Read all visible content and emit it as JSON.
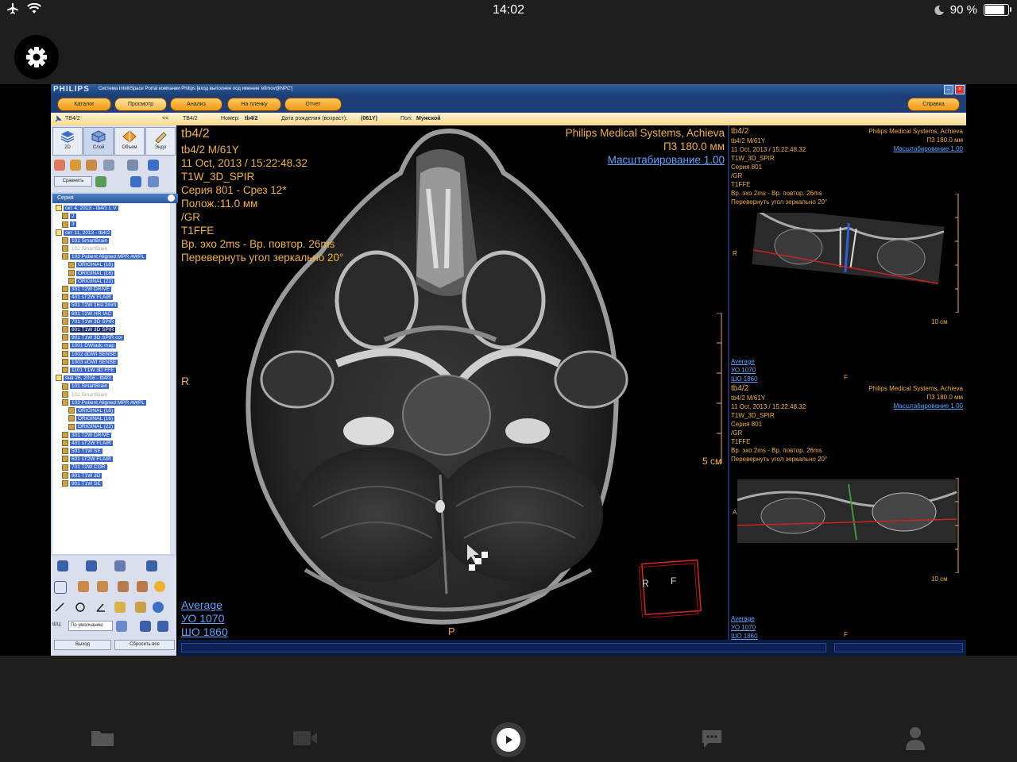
{
  "status_bar": {
    "time": "14:02",
    "battery": "90 %",
    "battery_level": 0.9
  },
  "app": {
    "brand": "PHILIPS",
    "window_title": "Система IntelliSpace Portal компании Philips [вход выполнен под именем 'efimov@NPC']",
    "menu": {
      "catalog": "Каталог",
      "view": "Просмотр",
      "analysis": "Анализ",
      "film": "На пленку",
      "report": "Отчет",
      "help": "Справка"
    },
    "infobar": {
      "patient_tab": "TB4/2",
      "collapse": "<<",
      "name": "TB4/2",
      "number_label": "Номер:",
      "number_value": "tb4/2",
      "dob_label": "Дата рождения (возраст):",
      "dob_value": "(061Y)",
      "sex_label": "Пол:",
      "sex_value": "Мужской"
    },
    "tools": {
      "btn_2d": "2D",
      "btn_slice": "Слой",
      "btn_volume": "Объем",
      "btn_endo": "Эндо",
      "compare": "Сравнить"
    },
    "series_header": "Серия",
    "series_tree": [
      {
        "label": "окт 4, 2013 - tb4/1 L V",
        "style": "blue",
        "indent": 0,
        "type": "study"
      },
      {
        "label": "2",
        "style": "blue",
        "indent": 1,
        "type": "series"
      },
      {
        "label": "3",
        "style": "blue",
        "indent": 1,
        "type": "series"
      },
      {
        "label": "окт 11, 2013 - tb4/2",
        "style": "blue",
        "indent": 0,
        "type": "study"
      },
      {
        "label": "101 SmartBrain",
        "style": "blue",
        "indent": 1,
        "type": "series"
      },
      {
        "label": "102 SmartBrain",
        "style": "grey",
        "indent": 1,
        "type": "series"
      },
      {
        "label": "103 Patient Aligned MPR AWPL",
        "style": "blue",
        "indent": 1,
        "type": "series"
      },
      {
        "label": "ORIGINAL (16)",
        "style": "blue",
        "indent": 2,
        "type": "series"
      },
      {
        "label": "ORIGINAL (16)",
        "style": "blue",
        "indent": 2,
        "type": "series"
      },
      {
        "label": "ORIGINAL (22)",
        "style": "blue",
        "indent": 2,
        "type": "series"
      },
      {
        "label": "301 T2W DRIVE",
        "style": "blue",
        "indent": 1,
        "type": "series"
      },
      {
        "label": "401 sT2W FLAIR",
        "style": "blue",
        "indent": 1,
        "type": "series"
      },
      {
        "label": "501 T2W 16sl 2mm",
        "style": "blue",
        "indent": 1,
        "type": "series"
      },
      {
        "label": "601 T2W HR IAC",
        "style": "blue",
        "indent": 1,
        "type": "series"
      },
      {
        "label": "701 T1W 3D SPIR",
        "style": "blue",
        "indent": 1,
        "type": "series"
      },
      {
        "label": "801 T1W 3D SPIR",
        "style": "dark",
        "indent": 1,
        "type": "series"
      },
      {
        "label": "901 T1W 3D SPIR cor",
        "style": "blue",
        "indent": 1,
        "type": "series"
      },
      {
        "label": "1001 DWIadc map",
        "style": "blue",
        "indent": 1,
        "type": "series"
      },
      {
        "label": "1002 dDWI SENSE",
        "style": "blue",
        "indent": 1,
        "type": "series"
      },
      {
        "label": "1003 eDWI SENSE",
        "style": "blue",
        "indent": 1,
        "type": "series"
      },
      {
        "label": "1101 T1W 3D FFE",
        "style": "blue",
        "indent": 1,
        "type": "series"
      },
      {
        "label": "янв 26, 2016 - tb4/3",
        "style": "blue",
        "indent": 0,
        "type": "study"
      },
      {
        "label": "101 SmartBrain",
        "style": "blue",
        "indent": 1,
        "type": "series"
      },
      {
        "label": "102 SmartBrain",
        "style": "grey",
        "indent": 1,
        "type": "series"
      },
      {
        "label": "103 Patient Aligned MPR AWPL",
        "style": "blue",
        "indent": 1,
        "type": "series"
      },
      {
        "label": "ORIGINAL (16)",
        "style": "blue",
        "indent": 2,
        "type": "series"
      },
      {
        "label": "ORIGINAL (16)",
        "style": "blue",
        "indent": 2,
        "type": "series"
      },
      {
        "label": "ORIGINAL (22)",
        "style": "blue",
        "indent": 2,
        "type": "series"
      },
      {
        "label": "301 T2W DRIVE",
        "style": "blue",
        "indent": 1,
        "type": "series"
      },
      {
        "label": "401 sT2W FLAIR",
        "style": "blue",
        "indent": 1,
        "type": "series"
      },
      {
        "label": "501 T1W SE",
        "style": "blue",
        "indent": 1,
        "type": "series"
      },
      {
        "label": "601 sT2W FLAIR",
        "style": "blue",
        "indent": 1,
        "type": "series"
      },
      {
        "label": "701 T2W COR",
        "style": "blue",
        "indent": 1,
        "type": "series"
      },
      {
        "label": "801 T1W 3D",
        "style": "blue",
        "indent": 1,
        "type": "series"
      },
      {
        "label": "901 T1W SE",
        "style": "blue",
        "indent": 1,
        "type": "series"
      }
    ],
    "bottom_tools": {
      "wl_label": "ШЦ:",
      "wl_select": "По умолчанию",
      "exit": "Выход",
      "reset_all": "Сбросить все"
    },
    "main_view": {
      "title": "tb4/2",
      "lines": [
        "tb4/2 M/61Y",
        "11 Oct, 2013 / 15:22:48.32",
        "T1W_3D_SPIR",
        "Серия 801 - Срез 12*",
        "Полож.:11.0 мм",
        "/GR",
        "T1FFE",
        "Вр. эхо   2ms - Вр. повтор.  26ms",
        "Перевернуть угол зеркально 20°"
      ],
      "vendor": "Philips Medical Systems, Achieva",
      "fov": "П3 180.0 мм",
      "zoom": "Масштабирование 1.00",
      "orient_r": "R",
      "orient_p": "P",
      "scale": "5 см",
      "wl_average": "Average",
      "wl_center": "УО   1070",
      "wl_width": "ШО  1860",
      "cube_r": "R",
      "cube_f": "F"
    },
    "side_view_1": {
      "title": "tb4/2",
      "lines": [
        "tb4/2 M/61Y",
        "11 Oct, 2013 / 15:22:48.32",
        "T1W_3D_SPIR",
        "Серия 801",
        "/GR",
        "T1FFE",
        "Вр. эхо   2ms - Вр. повтор.  26ms",
        "Перевернуть угол зеркально 20°"
      ],
      "vendor": "Philips Medical Systems, Achieva",
      "fov": "П3 180.0 мм",
      "zoom": "Масштабирование 1.00",
      "orient_r": "R",
      "orient_f": "F",
      "scale": "10 см",
      "wl_average": "Average",
      "wl_center": "УО   1070",
      "wl_width": "ШО   1860"
    },
    "side_view_2": {
      "title": "tb4/2",
      "lines": [
        "tb4/2 M/61Y",
        "11 Oct, 2013 / 15:22:48.32",
        "T1W_3D_SPIR",
        "Серия 801",
        "/GR",
        "T1FFE",
        "Вр. эхо   2ms - Вр. повтор.  26ms",
        "Перевернуть угол зеркально 20°"
      ],
      "vendor": "Philips Medical Systems, Achieva",
      "fov": "П3 180.0 мм",
      "zoom": "Масштабирование 1.00",
      "orient_a": "A",
      "orient_f": "F",
      "scale": "10 см",
      "wl_average": "Average",
      "wl_center": "УО   1070",
      "wl_width": "ШО   1860"
    }
  },
  "tab_bar": {
    "items": [
      "folder-icon",
      "video-icon",
      "play-icon",
      "chat-icon",
      "person-icon"
    ]
  },
  "colors": {
    "overlay_text": "#f2b13a",
    "link": "#5ea4ff",
    "menu_button": "#f29a15",
    "title_bar": "#2f5f9e"
  }
}
